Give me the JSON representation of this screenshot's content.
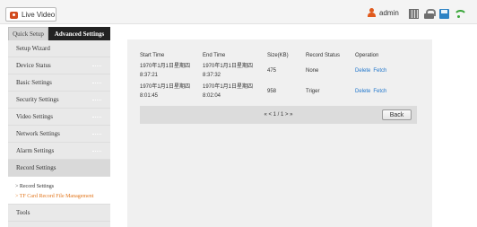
{
  "topbar": {
    "live_video_label": "Live Video",
    "user_name": "admin",
    "icons": [
      "user-icon",
      "grid-icon",
      "lock-icon",
      "save-icon",
      "wifi-icon"
    ]
  },
  "sidebar": {
    "tab_quick": "Quick Setup",
    "tab_advanced": "Advanced Settings",
    "items": [
      {
        "label": "Setup Wizard"
      },
      {
        "label": "Device Status"
      },
      {
        "label": "Basic Settings"
      },
      {
        "label": "Security Settings"
      },
      {
        "label": "Video Settings"
      },
      {
        "label": "Network Settings"
      },
      {
        "label": "Alarm Settings"
      },
      {
        "label": "Record Settings"
      }
    ],
    "subitems": [
      {
        "label": "> Record Settings"
      },
      {
        "label": "> TF Card Record File Management"
      }
    ],
    "tools_label": "Tools"
  },
  "table": {
    "headers": [
      "Start Time",
      "End Time",
      "Size(KB)",
      "Record Status",
      "Operation"
    ],
    "rows": [
      {
        "start_date": "1970年1月1日星期四",
        "start_time": "8:37:21",
        "end_date": "1970年1月1日星期四",
        "end_time": "8:37:32",
        "size": "475",
        "status": "None",
        "op_delete": "Delete",
        "op_fetch": "Fetch"
      },
      {
        "start_date": "1970年1月1日星期四",
        "start_time": "8:01:45",
        "end_date": "1970年1月1日星期四",
        "end_time": "8:02:04",
        "size": "958",
        "status": "Triger",
        "op_delete": "Delete",
        "op_fetch": "Fetch"
      }
    ]
  },
  "pager": {
    "text": "« < 1 / 1 > »",
    "back_label": "Back"
  },
  "colors": {
    "link": "#2277cc",
    "active_subitem": "#e2761c",
    "tab_active_bg": "#222222"
  }
}
